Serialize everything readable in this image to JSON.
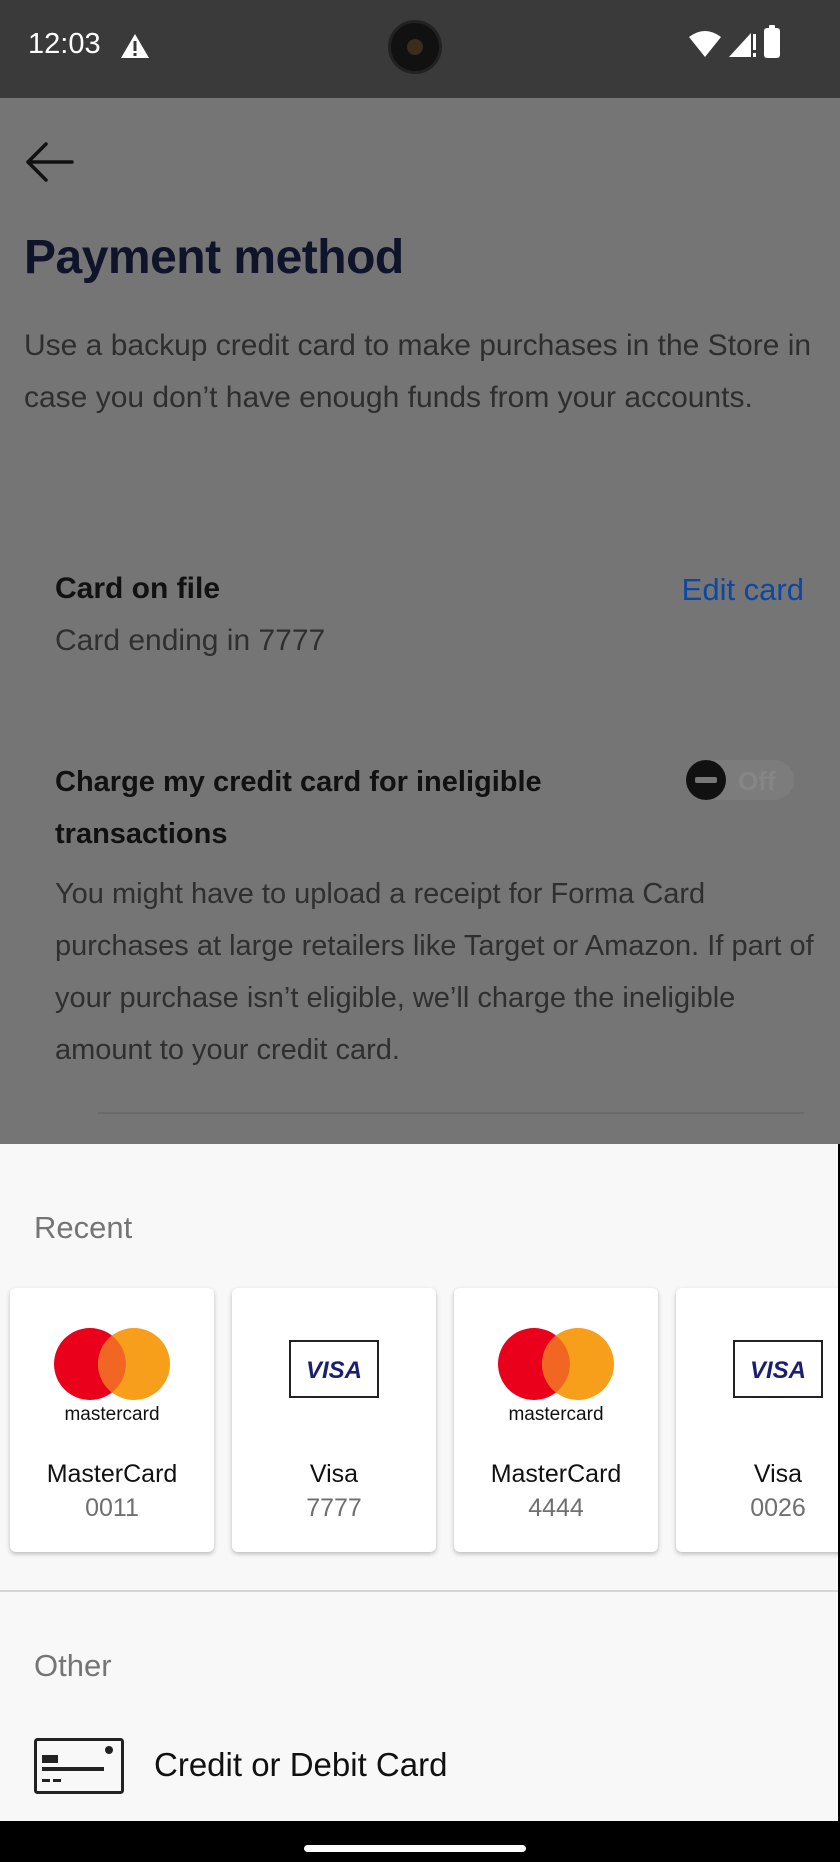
{
  "status_bar": {
    "time": "12:03"
  },
  "header": {
    "title": "Payment method"
  },
  "intro": "Use a backup credit card to make purchases in the Store in case you don’t have enough funds from your accounts.",
  "card_on_file": {
    "label": "Card on file",
    "value": "Card ending in 7777",
    "edit_label": "Edit card"
  },
  "charge_setting": {
    "label": "Charge my credit card for ineligible transactions",
    "toggle_text": "Off",
    "description": "You might have to upload a receipt for Forma Card purchases at large retailers like Target or Amazon. If part of your purchase isn’t eligible, we’ll charge the ineligible amount to your credit card."
  },
  "sheet": {
    "recent_title": "Recent",
    "cards": [
      {
        "brand": "MasterCard",
        "digits": "0011",
        "logo": "mastercard-logo",
        "logo_text": "mastercard"
      },
      {
        "brand": "Visa",
        "digits": "7777",
        "logo": "visa-logo",
        "logo_text": "VISA"
      },
      {
        "brand": "MasterCard",
        "digits": "4444",
        "logo": "mastercard-logo",
        "logo_text": "mastercard"
      },
      {
        "brand": "Visa",
        "digits": "0026",
        "logo": "visa-logo",
        "logo_text": "VISA"
      }
    ],
    "other_title": "Other",
    "other_option": "Credit or Debit Card"
  },
  "colors": {
    "accent": "#0D47A1",
    "mastercard_red": "#EB001B",
    "mastercard_orange": "#F79E1B",
    "visa_blue": "#1A1F71"
  }
}
